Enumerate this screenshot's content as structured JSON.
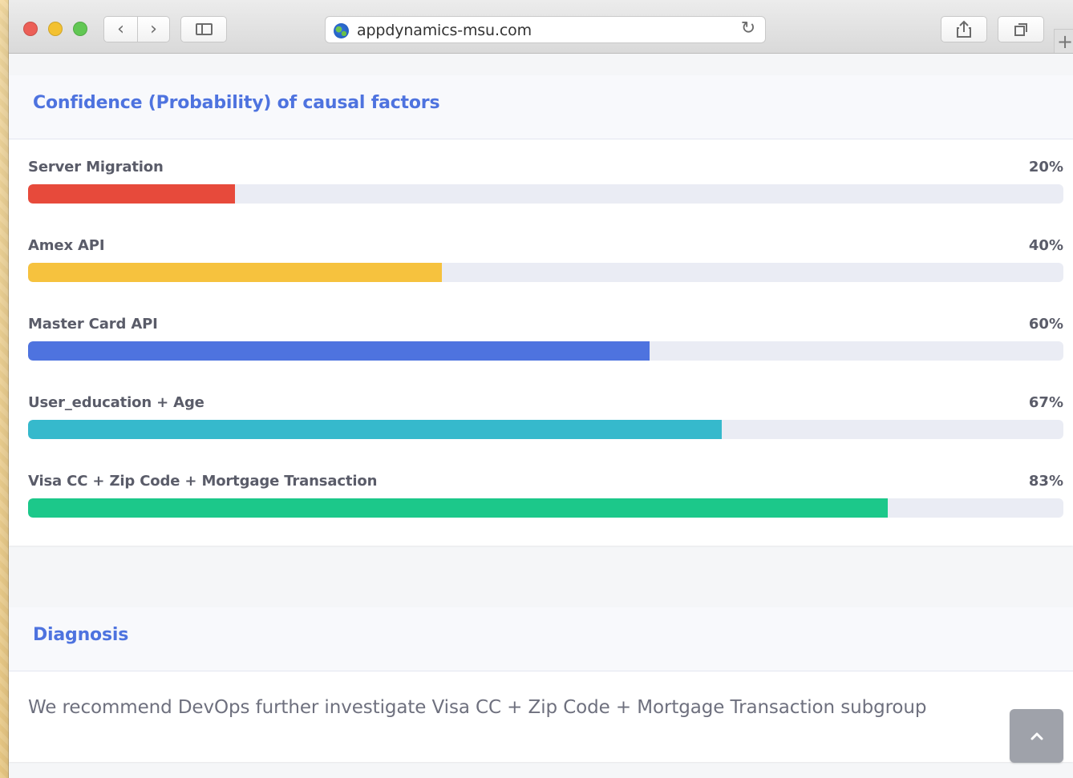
{
  "browser": {
    "url": "appdynamics-msu.com",
    "new_tab_label": "+",
    "icons": {
      "back": "chevron-left-icon",
      "forward": "chevron-right-icon",
      "sidebar": "sidebar-icon",
      "site": "globe-icon",
      "reload": "reload-icon",
      "share": "share-icon",
      "tabs": "tabs-icon"
    }
  },
  "confidence": {
    "title": "Confidence (Probability) of causal factors",
    "factors": [
      {
        "label": "Server Migration",
        "percent_label": "20%",
        "value": 20,
        "color": "#e74a3b"
      },
      {
        "label": "Amex API",
        "percent_label": "40%",
        "value": 40,
        "color": "#f6c23e"
      },
      {
        "label": "Master Card API",
        "percent_label": "60%",
        "value": 60,
        "color": "#4e73df"
      },
      {
        "label": "User_education + Age",
        "percent_label": "67%",
        "value": 67,
        "color": "#36b9cc"
      },
      {
        "label": "Visa CC + Zip Code + Mortgage Transaction",
        "percent_label": "83%",
        "value": 83,
        "color": "#1cc88a"
      }
    ]
  },
  "diagnosis": {
    "title": "Diagnosis",
    "text": "We recommend DevOps further investigate Visa CC + Zip Code + Mortgage Transaction subgroup"
  },
  "scroll_top_icon": "chevron-up-icon"
}
